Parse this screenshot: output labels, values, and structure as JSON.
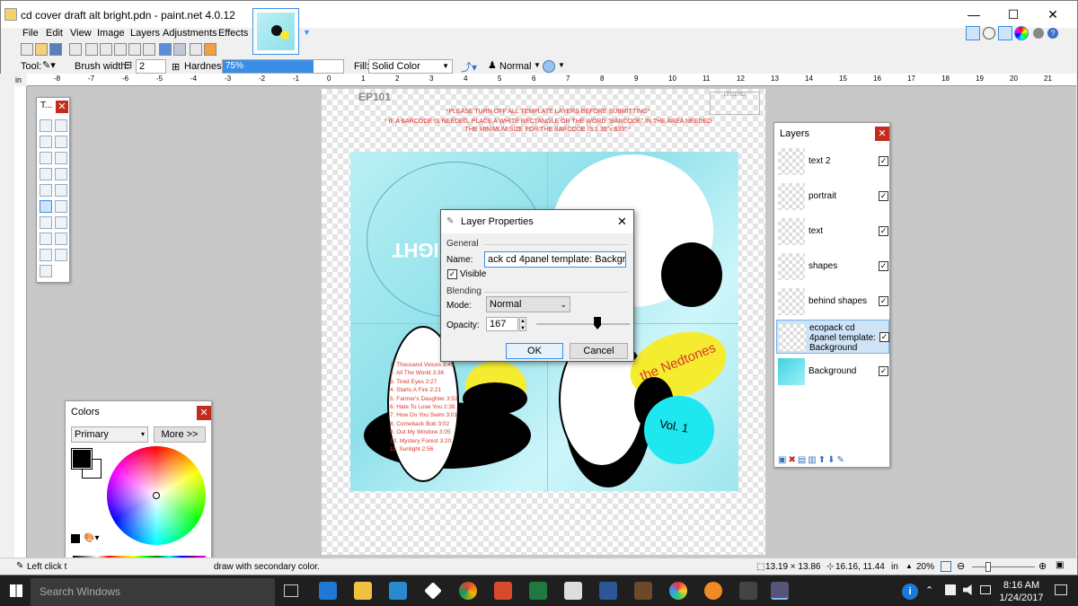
{
  "window": {
    "title": "cd cover draft alt bright.pdn - paint.net 4.0.12",
    "minimize": "—",
    "maximize": "☐",
    "close": "✕"
  },
  "menu": [
    "File",
    "Edit",
    "View",
    "Image",
    "Layers",
    "Adjustments",
    "Effects"
  ],
  "toolbar": {
    "tool_label": "Tool:",
    "brush_width_label": "Brush width:",
    "brush_width": "2",
    "hardness_label": "Hardness:",
    "hardness": "75%",
    "hardness_fraction": 0.75,
    "fill_label": "Fill:",
    "fill_value": "Solid Color",
    "blend_value": "Normal"
  },
  "rulers": {
    "unit": "in",
    "h_ticks": [
      "-8",
      "-7",
      "-6",
      "-5",
      "-4",
      "-3",
      "-2",
      "-1",
      "0",
      "1",
      "2",
      "3",
      "4",
      "5",
      "6",
      "7",
      "8",
      "9",
      "10",
      "11",
      "12",
      "13",
      "14",
      "15",
      "16",
      "17",
      "18",
      "19",
      "20",
      "21"
    ]
  },
  "tools_panel": {
    "title": "T..."
  },
  "colors_panel": {
    "title": "Colors",
    "primary": "Primary",
    "more": "More >>"
  },
  "layers_panel": {
    "title": "Layers",
    "layers": [
      {
        "name": "text 2",
        "checked": true
      },
      {
        "name": "portrait",
        "checked": true
      },
      {
        "name": "text",
        "checked": true
      },
      {
        "name": "shapes",
        "checked": true
      },
      {
        "name": "behind shapes",
        "checked": true
      },
      {
        "name": "ecopack cd 4panel template: Background",
        "checked": true,
        "selected": true
      },
      {
        "name": "Background",
        "checked": true
      }
    ]
  },
  "page": {
    "code": "EP101",
    "legend": "LEGEND",
    "warn1": "*PLEASE TURN OFF ALL TEMPLATE LAYERS BEFORE SUBMITTING*",
    "warn2": "* IF A BARCODE IS NEEDED, PLACE A WHITE RECTANGLE OR THE WORD \"BARCODE\" IN THE AREA NEEDED",
    "warn3": "THE MINIMUM SIZE FOR THE BARCODE IS 1.35\"x.635\" *",
    "tracks": [
      "1. Thousand Voices 3:45",
      "2. All The World 3:36",
      "3. Tired Eyes 2:27",
      "4. Starts A Fire 2:21",
      "5. Farmer's Daughter 3:53",
      "6. Hate To Lose You 2:38",
      "7. How Do You Swim 3:01",
      "8. Comeback Bob 3:02",
      "9. Out My Window 3:05",
      "10. Mystery Forest 3:20",
      "11. Sunlight 2:56"
    ],
    "band": "the Nedtones",
    "volume": "Vol. 1",
    "right_text": "RIGHT"
  },
  "dialog": {
    "title": "Layer Properties",
    "general": "General",
    "name_label": "Name:",
    "name_value": "ack cd 4panel template: Background",
    "visible": "Visible",
    "blending": "Blending",
    "mode_label": "Mode:",
    "mode_value": "Normal",
    "opacity_label": "Opacity:",
    "opacity_value": "167",
    "opacity_fraction": 0.655,
    "ok": "OK",
    "cancel": "Cancel"
  },
  "status": {
    "hint": "Left click t",
    "hint2": "draw with secondary color.",
    "size": "13.19 × 13.86",
    "pos": "16.16, 11.44",
    "unit": "in",
    "zoom": "20%"
  },
  "taskbar": {
    "search": "Search Windows",
    "time": "8:16 AM",
    "date": "1/24/2017"
  }
}
